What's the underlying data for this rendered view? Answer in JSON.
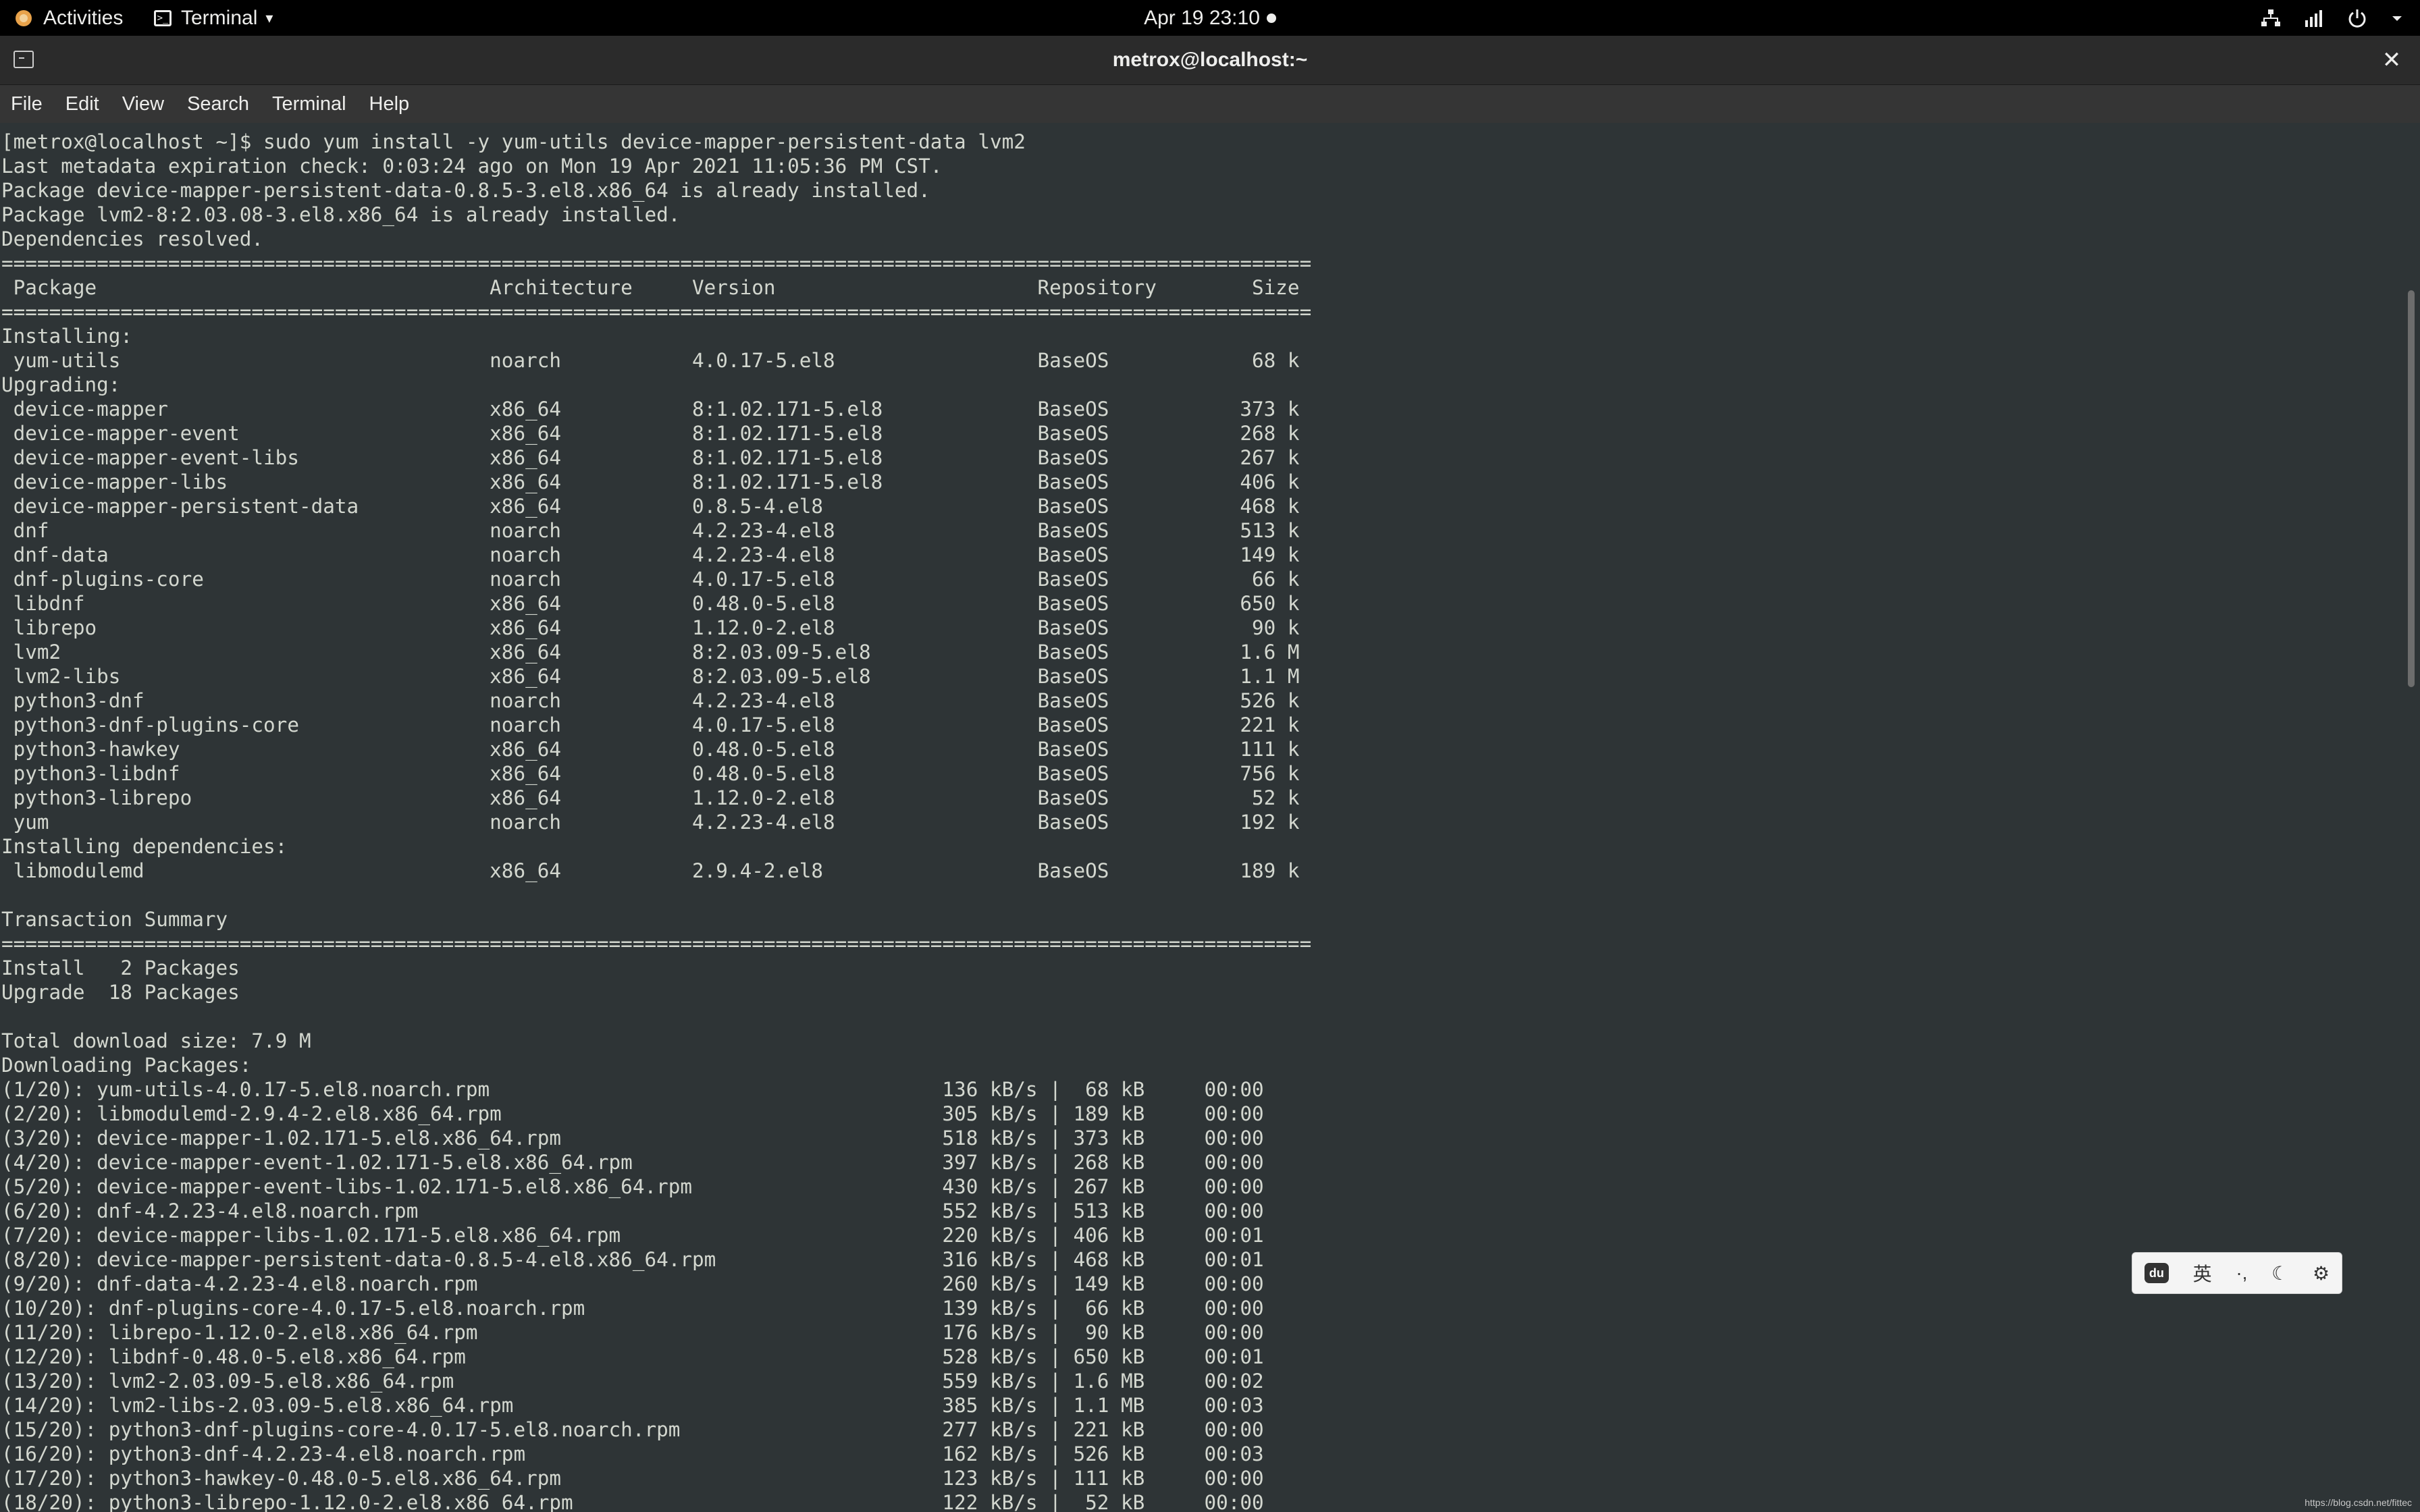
{
  "topbar": {
    "activities": "Activities",
    "app_menu": "Terminal",
    "clock": "Apr 19  23:10"
  },
  "window": {
    "title": "metrox@localhost:~",
    "close": "✕"
  },
  "menubar": {
    "items": [
      "File",
      "Edit",
      "View",
      "Search",
      "Terminal",
      "Help"
    ]
  },
  "terminal": {
    "lines": [
      "[metrox@localhost ~]$ sudo yum install -y yum-utils device-mapper-persistent-data lvm2",
      "Last metadata expiration check: 0:03:24 ago on Mon 19 Apr 2021 11:05:36 PM CST.",
      "Package device-mapper-persistent-data-0.8.5-3.el8.x86_64 is already installed.",
      "Package lvm2-8:2.03.08-3.el8.x86_64 is already installed.",
      "Dependencies resolved.",
      "==============================================================================================================",
      " Package                                 Architecture     Version                      Repository        Size",
      "==============================================================================================================",
      "Installing:",
      " yum-utils                               noarch           4.0.17-5.el8                 BaseOS            68 k",
      "Upgrading:",
      " device-mapper                           x86_64           8:1.02.171-5.el8             BaseOS           373 k",
      " device-mapper-event                     x86_64           8:1.02.171-5.el8             BaseOS           268 k",
      " device-mapper-event-libs                x86_64           8:1.02.171-5.el8             BaseOS           267 k",
      " device-mapper-libs                      x86_64           8:1.02.171-5.el8             BaseOS           406 k",
      " device-mapper-persistent-data           x86_64           0.8.5-4.el8                  BaseOS           468 k",
      " dnf                                     noarch           4.2.23-4.el8                 BaseOS           513 k",
      " dnf-data                                noarch           4.2.23-4.el8                 BaseOS           149 k",
      " dnf-plugins-core                        noarch           4.0.17-5.el8                 BaseOS            66 k",
      " libdnf                                  x86_64           0.48.0-5.el8                 BaseOS           650 k",
      " librepo                                 x86_64           1.12.0-2.el8                 BaseOS            90 k",
      " lvm2                                    x86_64           8:2.03.09-5.el8              BaseOS           1.6 M",
      " lvm2-libs                               x86_64           8:2.03.09-5.el8              BaseOS           1.1 M",
      " python3-dnf                             noarch           4.2.23-4.el8                 BaseOS           526 k",
      " python3-dnf-plugins-core                noarch           4.0.17-5.el8                 BaseOS           221 k",
      " python3-hawkey                          x86_64           0.48.0-5.el8                 BaseOS           111 k",
      " python3-libdnf                          x86_64           0.48.0-5.el8                 BaseOS           756 k",
      " python3-librepo                         x86_64           1.12.0-2.el8                 BaseOS            52 k",
      " yum                                     noarch           4.2.23-4.el8                 BaseOS           192 k",
      "Installing dependencies:",
      " libmodulemd                             x86_64           2.9.4-2.el8                  BaseOS           189 k",
      "",
      "Transaction Summary",
      "==============================================================================================================",
      "Install   2 Packages",
      "Upgrade  18 Packages",
      "",
      "Total download size: 7.9 M",
      "Downloading Packages:",
      "(1/20): yum-utils-4.0.17-5.el8.noarch.rpm                                      136 kB/s |  68 kB     00:00",
      "(2/20): libmodulemd-2.9.4-2.el8.x86_64.rpm                                     305 kB/s | 189 kB     00:00",
      "(3/20): device-mapper-1.02.171-5.el8.x86_64.rpm                                518 kB/s | 373 kB     00:00",
      "(4/20): device-mapper-event-1.02.171-5.el8.x86_64.rpm                          397 kB/s | 268 kB     00:00",
      "(5/20): device-mapper-event-libs-1.02.171-5.el8.x86_64.rpm                     430 kB/s | 267 kB     00:00",
      "(6/20): dnf-4.2.23-4.el8.noarch.rpm                                            552 kB/s | 513 kB     00:00",
      "(7/20): device-mapper-libs-1.02.171-5.el8.x86_64.rpm                           220 kB/s | 406 kB     00:01",
      "(8/20): device-mapper-persistent-data-0.8.5-4.el8.x86_64.rpm                   316 kB/s | 468 kB     00:01",
      "(9/20): dnf-data-4.2.23-4.el8.noarch.rpm                                       260 kB/s | 149 kB     00:00",
      "(10/20): dnf-plugins-core-4.0.17-5.el8.noarch.rpm                              139 kB/s |  66 kB     00:00",
      "(11/20): librepo-1.12.0-2.el8.x86_64.rpm                                       176 kB/s |  90 kB     00:00",
      "(12/20): libdnf-0.48.0-5.el8.x86_64.rpm                                        528 kB/s | 650 kB     00:01",
      "(13/20): lvm2-2.03.09-5.el8.x86_64.rpm                                         559 kB/s | 1.6 MB     00:02",
      "(14/20): lvm2-libs-2.03.09-5.el8.x86_64.rpm                                    385 kB/s | 1.1 MB     00:03",
      "(15/20): python3-dnf-plugins-core-4.0.17-5.el8.noarch.rpm                      277 kB/s | 221 kB     00:00",
      "(16/20): python3-dnf-4.2.23-4.el8.noarch.rpm                                   162 kB/s | 526 kB     00:03",
      "(17/20): python3-hawkey-0.48.0-5.el8.x86_64.rpm                                123 kB/s | 111 kB     00:00",
      "(18/20): python3-librepo-1.12.0-2.el8.x86_64.rpm                               122 kB/s |  52 kB     00:00"
    ]
  },
  "ime": {
    "logo": "du",
    "lang": "英",
    "punct": "·,",
    "moon": "☾",
    "settings": "⚙"
  },
  "watermark": "https://blog.csdn.net/fittec"
}
